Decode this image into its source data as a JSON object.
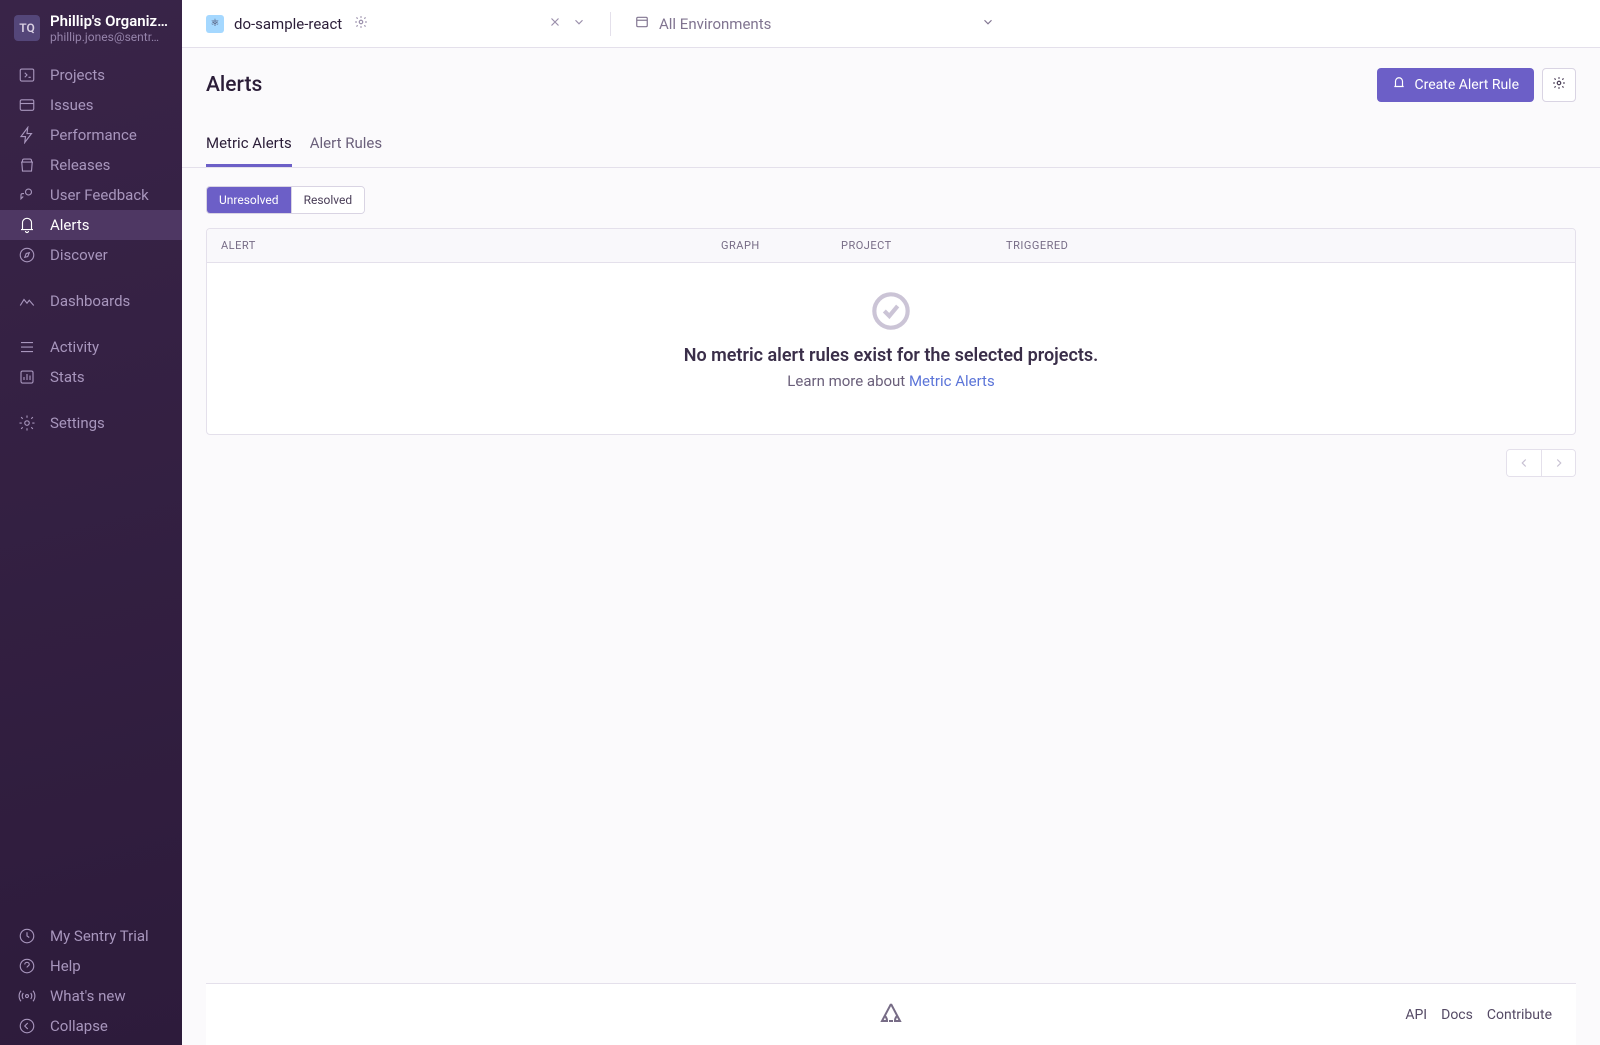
{
  "org": {
    "avatar": "TQ",
    "name": "Phillip's Organiz…",
    "email": "phillip.jones@sentr…"
  },
  "nav": {
    "items": [
      {
        "label": "Projects"
      },
      {
        "label": "Issues"
      },
      {
        "label": "Performance"
      },
      {
        "label": "Releases"
      },
      {
        "label": "User Feedback"
      },
      {
        "label": "Alerts"
      },
      {
        "label": "Discover"
      }
    ],
    "items2": [
      {
        "label": "Dashboards"
      }
    ],
    "items3": [
      {
        "label": "Activity"
      },
      {
        "label": "Stats"
      }
    ],
    "items4": [
      {
        "label": "Settings"
      }
    ],
    "bottom": [
      {
        "label": "My Sentry Trial"
      },
      {
        "label": "Help"
      },
      {
        "label": "What's new"
      },
      {
        "label": "Collapse"
      }
    ]
  },
  "topbar": {
    "project": "do-sample-react",
    "env": "All Environments"
  },
  "page": {
    "title": "Alerts",
    "create_btn": "Create Alert Rule"
  },
  "tabs": {
    "metric_alerts": "Metric Alerts",
    "alert_rules": "Alert Rules"
  },
  "filter": {
    "unresolved": "Unresolved",
    "resolved": "Resolved"
  },
  "table": {
    "alert": "Alert",
    "graph": "Graph",
    "project": "Project",
    "triggered": "Triggered"
  },
  "empty": {
    "title": "No metric alert rules exist for the selected projects.",
    "sub_prefix": "Learn more about ",
    "sub_link": "Metric Alerts"
  },
  "footer": {
    "api": "API",
    "docs": "Docs",
    "contribute": "Contribute"
  }
}
